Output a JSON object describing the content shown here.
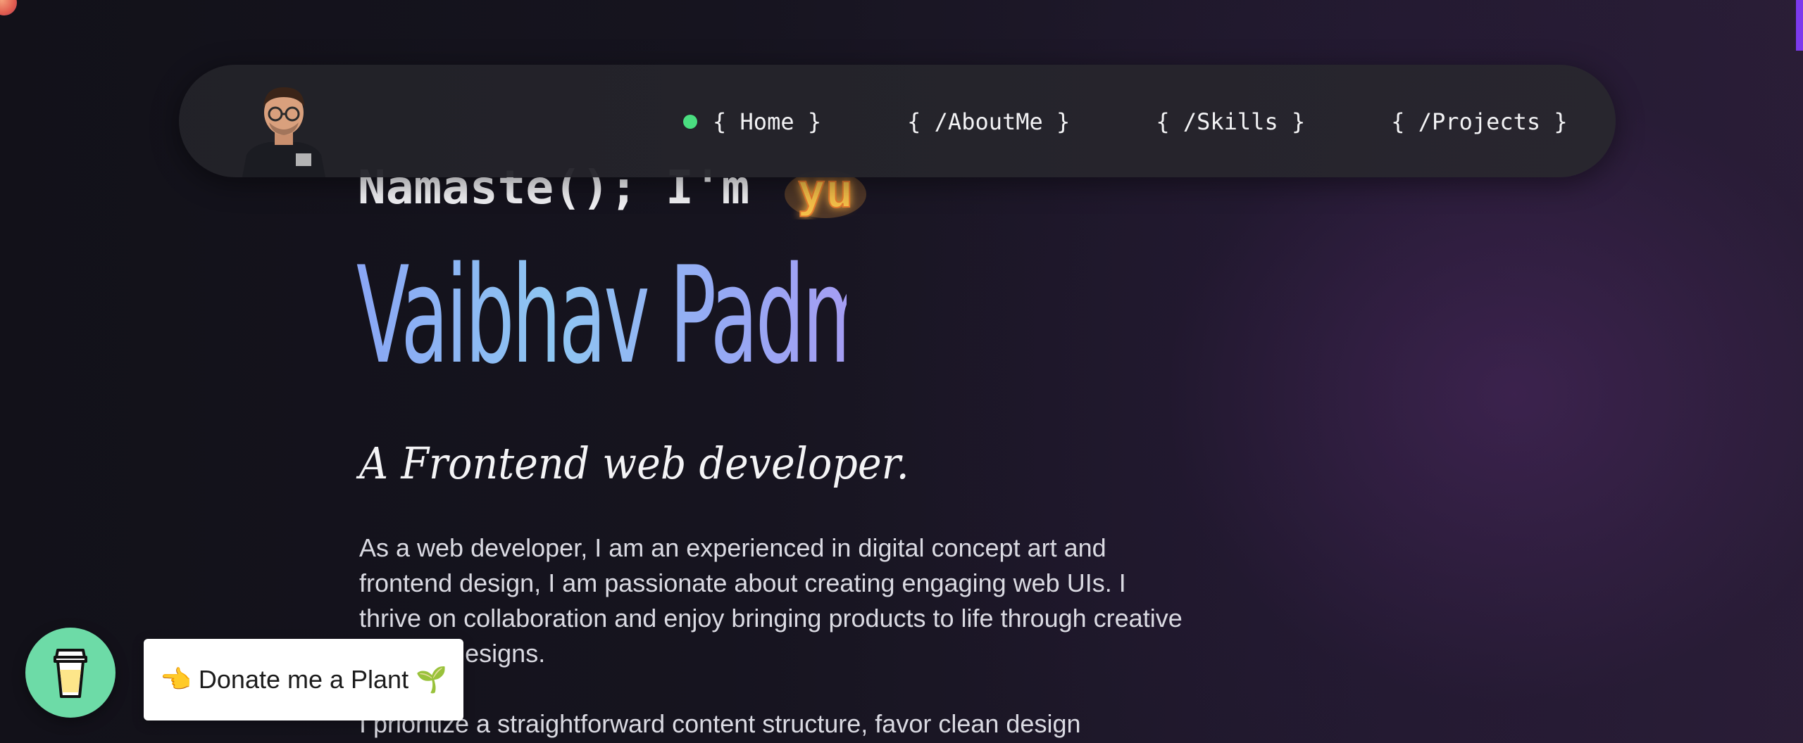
{
  "colors": {
    "accent_scroll": "#7c3aed",
    "status_dot": "#4ade80",
    "name_gradient_start": "#8aa6f5",
    "name_gradient_end": "#a59ef3",
    "donate_button": "#6ddba7",
    "glow": "#f5b841"
  },
  "nav": {
    "avatar_icon": "avatar-icon",
    "active_indicator": "status-dot-icon",
    "items": [
      {
        "label": "{ Home }",
        "active": true
      },
      {
        "label": "{ /AboutMe }",
        "active": false
      },
      {
        "label": "{ /Skills }",
        "active": false
      },
      {
        "label": "{ /Projects }",
        "active": false
      }
    ]
  },
  "hero": {
    "greeting": "Namaste(); I'm",
    "glow_glyph": "yu",
    "name": "Vaibhav Padmani.",
    "tagline": "A Frontend web developer.",
    "paragraphs": [
      "As a web developer, I am an experienced in digital concept art and frontend design, I am passionate about creating engaging web UIs. I thrive on collaboration and enjoy bringing products to life through creative and fun designs.",
      "I prioritize a straightforward content structure, favor clean design"
    ]
  },
  "donate": {
    "coffee_icon": "coffee-cup-icon",
    "label": "👈 Donate me a Plant 🌱"
  }
}
